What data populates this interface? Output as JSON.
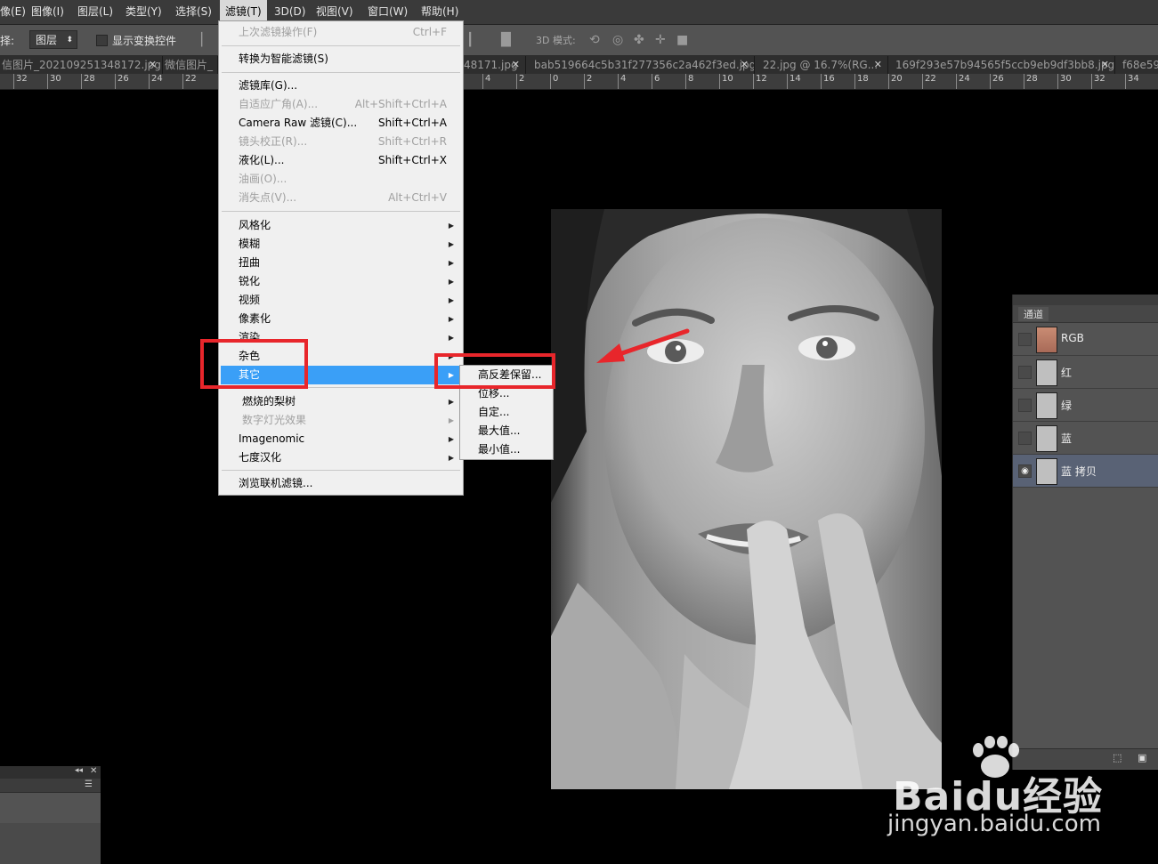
{
  "menubar": {
    "items": [
      "像(E)",
      "图像(I)",
      "图层(L)",
      "类型(Y)",
      "选择(S)",
      "滤镜(T)",
      "3D(D)",
      "视图(V)",
      "窗口(W)",
      "帮助(H)"
    ],
    "active": "滤镜(T)"
  },
  "options": {
    "select_label": "择:",
    "select_value": "图层",
    "show_transform": "显示变换控件",
    "mode_3d": "3D 模式:"
  },
  "tabs": [
    "信图片_20210925134817​2.jpg",
    "微信图片_",
    "48171.jpg",
    "bab519664c5b31f277356c2a462f3ed.jpg",
    "22.jpg @ 16.7%(RG...",
    "169f293e57b94565f5ccb9eb9df3bb8.jpg",
    "f68e59"
  ],
  "ruler": {
    "left": [
      "32",
      "30",
      "28",
      "26",
      "24",
      "22"
    ],
    "right": [
      "4",
      "2",
      "0",
      "2",
      "4",
      "6",
      "8",
      "10",
      "12",
      "14",
      "16",
      "18",
      "20",
      "22",
      "24",
      "26",
      "28",
      "30",
      "32",
      "34"
    ]
  },
  "filter_menu": {
    "last_filter": "上次滤镜操作(F)",
    "last_filter_sc": "Ctrl+F",
    "smart": "转换为智能滤镜(S)",
    "gallery": "滤镜库(G)...",
    "adaptive": "自适应广角(A)...",
    "adaptive_sc": "Alt+Shift+Ctrl+A",
    "camera_raw": "Camera Raw 滤镜(C)...",
    "camera_raw_sc": "Shift+Ctrl+A",
    "lens": "镜头校正(R)...",
    "lens_sc": "Shift+Ctrl+R",
    "liquify": "液化(L)...",
    "liquify_sc": "Shift+Ctrl+X",
    "oil": "油画(O)...",
    "vanish": "消失点(V)...",
    "vanish_sc": "Alt+Ctrl+V",
    "stylize": "风格化",
    "blur": "模糊",
    "distort": "扭曲",
    "sharpen": "锐化",
    "video": "视频",
    "pixelate": "像素化",
    "render": "渲染",
    "noise": "杂色",
    "other": "其它",
    "burn_pear": "燃烧的梨树",
    "digital_light": "数字灯光效果",
    "imagenomic": "Imagenomic",
    "qidu": "七度汉化",
    "browse": "浏览联机滤镜..."
  },
  "submenu": {
    "high_pass": "高反差保留...",
    "offset": "位移...",
    "custom": "自定...",
    "maximum": "最大值...",
    "minimum": "最小值..."
  },
  "channels": {
    "tab": "通道",
    "rows": [
      "RGB",
      "红",
      "绿",
      "蓝",
      "蓝 拷贝"
    ],
    "selected": "蓝 拷贝"
  },
  "watermark": {
    "line1": "Baidu经验",
    "line2": "jingyan.baidu.com"
  },
  "colors": {
    "highlight": "#3a9ff7",
    "annotation_red": "#e8262b"
  }
}
